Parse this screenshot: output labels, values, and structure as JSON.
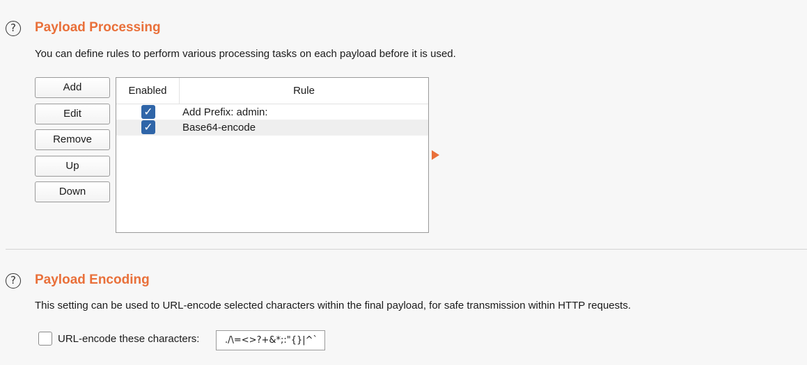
{
  "processing": {
    "help_icon": "?",
    "title": "Payload Processing",
    "description": "You can define rules to perform various processing tasks on each payload before it is used.",
    "buttons": {
      "add": "Add",
      "edit": "Edit",
      "remove": "Remove",
      "up": "Up",
      "down": "Down"
    },
    "table": {
      "columns": [
        "Enabled",
        "Rule"
      ],
      "rows": [
        {
          "enabled": true,
          "rule": "Add Prefix: admin:"
        },
        {
          "enabled": true,
          "rule": "Base64-encode"
        }
      ]
    }
  },
  "encoding": {
    "help_icon": "?",
    "title": "Payload Encoding",
    "description": "This setting can be used to URL-encode selected characters within the final payload, for safe transmission within HTTP requests.",
    "checkbox_label": "URL-encode these characters:",
    "checkbox_checked": false,
    "characters": "./\\=<>?+&*;:\"{}|^`"
  },
  "icons": {
    "help": "help-circle-icon",
    "check": "checkmark-icon",
    "expand_arrow": "triangle-right-icon"
  },
  "colors": {
    "accent": "#e9703a",
    "checkbox": "#2f65a8",
    "background": "#f7f7f7"
  }
}
